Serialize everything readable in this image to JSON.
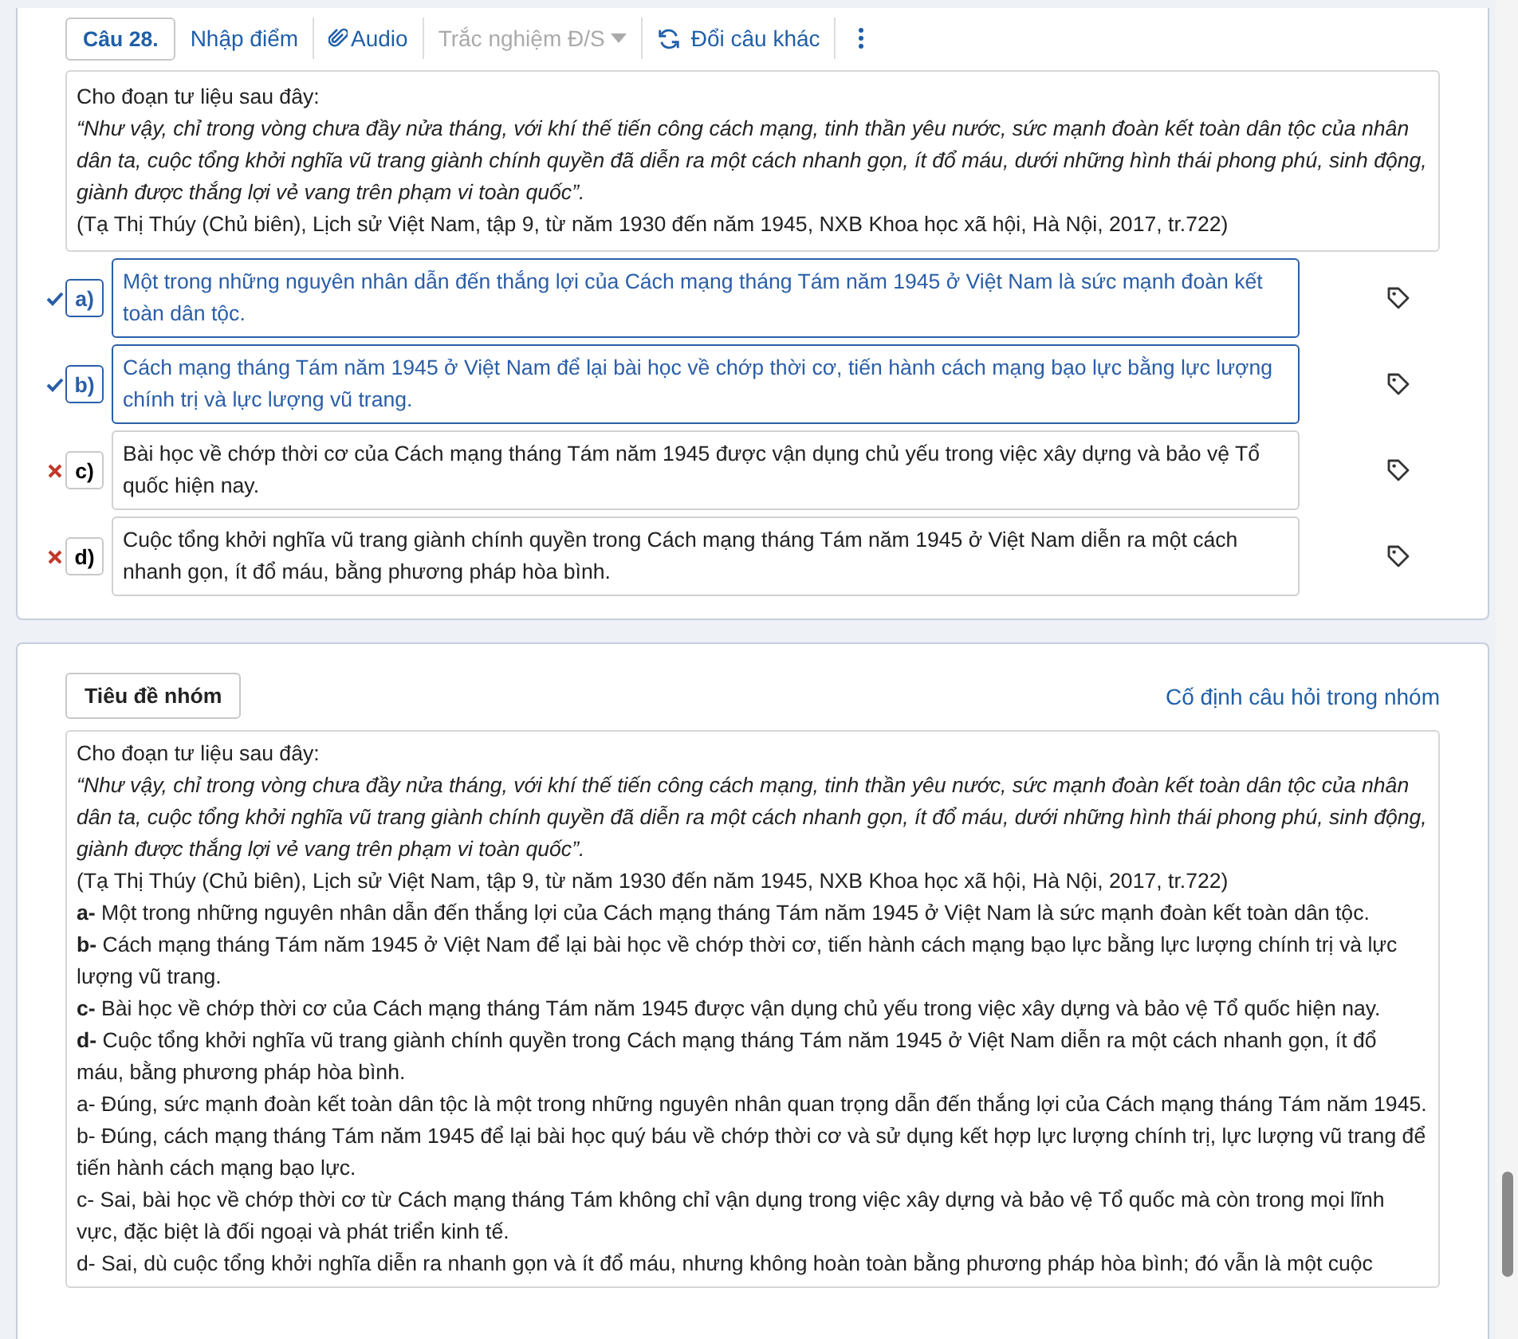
{
  "question": {
    "number": "Câu 28.",
    "toolbar": {
      "score_link": "Nhập điểm",
      "audio_link": "Audio",
      "type_select": {
        "value": "Trắc nghiệm Đ/S",
        "disabled": true
      },
      "swap_link": "Đổi câu khác"
    },
    "passage": {
      "intro": "Cho đoạn tư liệu sau đây:",
      "quote": "“Như vậy, chỉ trong vòng chưa đầy nửa tháng, với khí thế tiến công cách mạng, tinh thần yêu nước, sức mạnh đoàn kết toàn dân tộc của nhân dân ta, cuộc tổng khởi nghĩa vũ trang giành chính quyền đã diễn ra một cách nhanh gọn, ít đổ máu, dưới những hình thái phong phú, sinh động, giành được thắng lợi vẻ vang trên phạm vi toàn quốc”.",
      "source": "(Tạ Thị Thúy (Chủ biên), Lịch sử Việt Nam, tập 9, từ năm 1930 đến năm 1945, NXB Khoa học xã hội, Hà Nội, 2017, tr.722)"
    },
    "options": [
      {
        "label": "a)",
        "text": "Một trong những nguyên nhân dẫn đến thắng lợi của Cách mạng tháng Tám năm 1945 ở Việt Nam là sức mạnh đoàn kết toàn dân tộc.",
        "correct": true
      },
      {
        "label": "b)",
        "text": "Cách mạng tháng Tám năm 1945 ở Việt Nam để lại bài học về chớp thời cơ, tiến hành cách mạng bạo lực bằng lực lượng chính trị và lực lượng vũ trang.",
        "correct": true
      },
      {
        "label": "c)",
        "text": "Bài học về chớp thời cơ của Cách mạng tháng Tám năm 1945 được vận dụng chủ yếu trong việc xây dựng và bảo vệ Tổ quốc hiện nay.",
        "correct": false
      },
      {
        "label": "d)",
        "text": "Cuộc tổng khởi nghĩa vũ trang giành chính quyền trong Cách mạng tháng Tám năm 1945 ở Việt Nam diễn ra một cách nhanh gọn, ít đổ máu, bằng phương pháp hòa bình.",
        "correct": false
      }
    ]
  },
  "group": {
    "title_button": "Tiêu đề nhóm",
    "pin_link": "Cố định câu hỏi trong nhóm",
    "content": [
      {
        "kind": "plain",
        "text": "Cho đoạn tư liệu sau đây:"
      },
      {
        "kind": "quote",
        "text": "“Như vậy, chỉ trong vòng chưa đầy nửa tháng, với khí thế tiến công cách mạng, tinh thần yêu nước, sức mạnh đoàn kết toàn dân tộc của nhân dân ta, cuộc tổng khởi nghĩa vũ trang giành chính quyền đã diễn ra một cách nhanh gọn, ít đổ máu, dưới những hình thái phong phú, sinh động, giành được thắng lợi vẻ vang trên phạm vi toàn quốc”."
      },
      {
        "kind": "plain",
        "text": "(Tạ Thị Thúy (Chủ biên), Lịch sử Việt Nam, tập 9, từ năm 1930 đến năm 1945, NXB Khoa học xã hội, Hà Nội, 2017, tr.722)"
      },
      {
        "kind": "plain",
        "text": "**a-** Một trong những nguyên nhân dẫn đến thắng lợi của Cách mạng tháng Tám năm 1945 ở Việt Nam là sức mạnh đoàn kết toàn dân tộc."
      },
      {
        "kind": "plain",
        "text": "**b-** Cách mạng tháng Tám năm 1945 ở Việt Nam để lại bài học về chớp thời cơ, tiến hành cách mạng bạo lực bằng lực lượng chính trị và lực lượng vũ trang."
      },
      {
        "kind": "plain",
        "text": "**c-** Bài học về chớp thời cơ của Cách mạng tháng Tám năm 1945 được vận dụng chủ yếu trong việc xây dựng và bảo vệ Tổ quốc hiện nay."
      },
      {
        "kind": "plain",
        "text": "**d-** Cuộc tổng khởi nghĩa vũ trang giành chính quyền trong Cách mạng tháng Tám năm 1945 ở Việt Nam diễn ra một cách nhanh gọn, ít đổ máu, bằng phương pháp hòa bình."
      },
      {
        "kind": "plain",
        "text": "a- Đúng, sức mạnh đoàn kết toàn dân tộc là một trong những nguyên nhân quan trọng dẫn đến thắng lợi của Cách mạng tháng Tám năm 1945."
      },
      {
        "kind": "plain",
        "text": "b- Đúng, cách mạng tháng Tám năm 1945 để lại bài học quý báu về chớp thời cơ và sử dụng kết hợp lực lượng chính trị, lực lượng vũ trang để tiến hành cách mạng bạo lực."
      },
      {
        "kind": "plain",
        "text": "c- Sai, bài học về chớp thời cơ từ Cách mạng tháng Tám không chỉ vận dụng trong việc xây dựng và bảo vệ Tổ quốc mà còn trong mọi lĩnh vực, đặc biệt là đối ngoại và phát triển kinh tế."
      },
      {
        "kind": "plain",
        "text": "d- Sai, dù cuộc tổng khởi nghĩa diễn ra nhanh gọn và ít đổ máu, nhưng không hoàn toàn bằng phương pháp hòa bình; đó vẫn là một cuộc"
      }
    ]
  }
}
